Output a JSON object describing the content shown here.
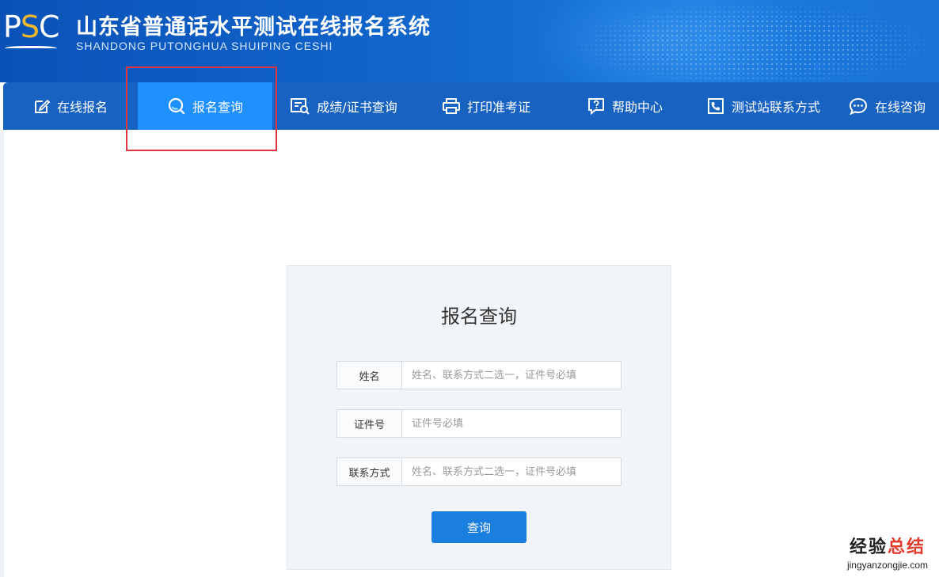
{
  "header": {
    "logo_text_p": "P",
    "logo_text_s": "S",
    "logo_text_c": "C",
    "title": "山东省普通话水平测试在线报名系统",
    "subtitle": "SHANDONG PUTONGHUA SHUIPING CESHI"
  },
  "nav": {
    "items": [
      {
        "label": "在线报名",
        "icon": "edit-icon"
      },
      {
        "label": "报名查询",
        "icon": "search-icon",
        "active": true
      },
      {
        "label": "成绩/证书查询",
        "icon": "certificate-search-icon"
      },
      {
        "label": "打印准考证",
        "icon": "printer-icon"
      },
      {
        "label": "帮助中心",
        "icon": "help-icon"
      },
      {
        "label": "测试站联系方式",
        "icon": "phone-icon"
      },
      {
        "label": "在线咨询",
        "icon": "chat-icon"
      }
    ]
  },
  "form": {
    "title": "报名查询",
    "fields": [
      {
        "label": "姓名",
        "placeholder": "姓名、联系方式二选一，证件号必填",
        "value": ""
      },
      {
        "label": "证件号",
        "placeholder": "证件号必填",
        "value": ""
      },
      {
        "label": "联系方式",
        "placeholder": "姓名、联系方式二选一，证件号必填",
        "value": ""
      }
    ],
    "submit_label": "查询"
  },
  "watermark": {
    "top_black": "经验",
    "top_red": "总结",
    "bottom": "jingyanzongjie.com"
  },
  "colors": {
    "header_bg": "#1166cc",
    "nav_bg": "#1863c2",
    "nav_active": "#1e90ff",
    "button": "#1b7fe0",
    "highlight": "#e0353f",
    "logo_accent": "#f3b92b"
  }
}
